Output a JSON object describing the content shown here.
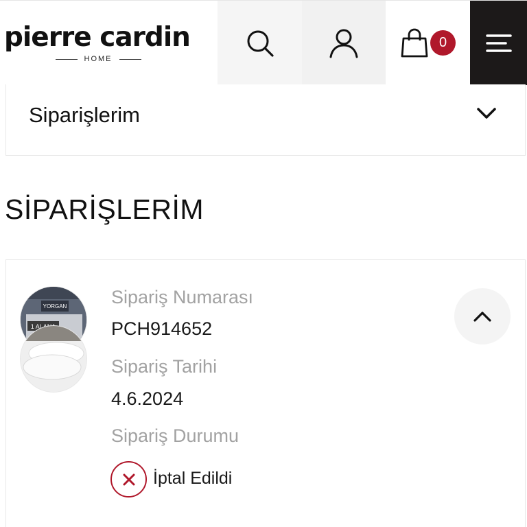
{
  "header": {
    "logo_text": "pierre cardin",
    "logo_subtext": "HOME",
    "cart_count": "0",
    "icons": {
      "search": "search-icon",
      "user": "user-icon",
      "cart": "shopping-bag-icon",
      "menu": "hamburger-menu-icon"
    }
  },
  "dropdown": {
    "selected": "Siparişlerim"
  },
  "page": {
    "title": "SİPARİŞLERİM"
  },
  "order": {
    "number_label": "Sipariş Numarası",
    "number_value": "PCH914652",
    "date_label": "Sipariş Tarihi",
    "date_value": "4.6.2024",
    "status_label": "Sipariş Durumu",
    "status_value": "İptal Edildi",
    "product_thumb_1_text": "YORGAN",
    "product_thumb_1_badge": "1 ALANA"
  },
  "colors": {
    "brand_red": "#b0182b",
    "menu_bg": "#1c1919",
    "label_gray": "#a2a2a2"
  }
}
